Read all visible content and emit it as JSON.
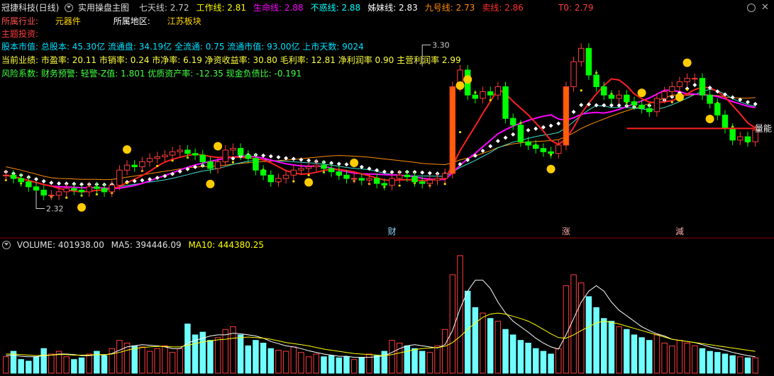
{
  "header": {
    "stock_name": "冠捷科技(日线)",
    "indicator_name": "实用操盘主图",
    "lines": [
      {
        "label": "七天线:",
        "value": "2.72",
        "color": "#c8c8c8"
      },
      {
        "label": "工作线:",
        "value": "2.81",
        "color": "#ffff00"
      },
      {
        "label": "生命线:",
        "value": "2.88",
        "color": "#ff00ff"
      },
      {
        "label": "不惑线:",
        "value": "2.88",
        "color": "#00ffff"
      },
      {
        "label": "姊妹线:",
        "value": "2.83",
        "color": "#ffffff"
      },
      {
        "label": "九号线:",
        "value": "2.73",
        "color": "#ff8c00"
      },
      {
        "label": "卖线:",
        "value": "2.86",
        "color": "#ff3030"
      }
    ],
    "t0": "T0: 2.79"
  },
  "info": {
    "industry_label": "所属行业:",
    "industry_value": "元器件",
    "region_label": "所属地区:",
    "region_value": "江苏板块",
    "theme_label": "主题投资:",
    "line1": "股本市值: 总股本: 45.30亿 流通盘: 34.19亿 全流通: 0.75 流通市值: 93.00亿 上市天数: 9024",
    "line2": "当前业绩: 市盈率: 20.11 市销率: 0.24 市净率: 6.19 净资收益率: 30.80 毛利率: 12.81 净利润率 0.90 主营利润率 2.99",
    "line3": "风险系数: 财务预警: 轻警-Z值: 1.801 优质资产率: -12.35 现金负债比: -0.191"
  },
  "volume_header": {
    "volume": "VOLUME: 401938.00",
    "ma5": "MA5: 394446.09",
    "ma10": "MA10: 444380.25"
  },
  "chart_data": {
    "type": "candlestick",
    "price_ylim": [
      2.22,
      3.4
    ],
    "annotations": {
      "high_label": "3.30",
      "low_label": "2.32",
      "right_label": "量能"
    },
    "event_markers": [
      {
        "label": "财",
        "index": 51
      },
      {
        "label": "涨",
        "index": 74
      },
      {
        "label": "減",
        "index": 89
      }
    ],
    "colors": {
      "up": "#ff3c3c",
      "down": "#00e8e8",
      "down_candle": "#00ff00",
      "yellow": "#ffd700",
      "magenta": "#ff00ff",
      "white": "#ffffff",
      "orange": "#ff8c00"
    },
    "closes": [
      2.52,
      2.5,
      2.48,
      2.45,
      2.43,
      2.4,
      2.4,
      2.42,
      2.44,
      2.43,
      2.42,
      2.45,
      2.44,
      2.42,
      2.46,
      2.55,
      2.58,
      2.57,
      2.6,
      2.62,
      2.63,
      2.64,
      2.66,
      2.67,
      2.65,
      2.64,
      2.6,
      2.56,
      2.6,
      2.67,
      2.68,
      2.64,
      2.62,
      2.55,
      2.52,
      2.48,
      2.5,
      2.52,
      2.55,
      2.56,
      2.57,
      2.58,
      2.56,
      2.54,
      2.52,
      2.5,
      2.5,
      2.49,
      2.5,
      2.47,
      2.46,
      2.5,
      2.52,
      2.51,
      2.48,
      2.47,
      2.49,
      2.5,
      2.53,
      3.05,
      3.15,
      3.0,
      2.98,
      3.02,
      3.0,
      3.05,
      2.86,
      2.82,
      2.72,
      2.7,
      2.68,
      2.66,
      2.65,
      2.7,
      3.05,
      3.2,
      3.28,
      3.12,
      3.05,
      3.0,
      2.98,
      3.0,
      2.96,
      2.94,
      2.92,
      2.9,
      2.98,
      3.02,
      3.05,
      3.08,
      3.1,
      3.1,
      3.0,
      2.95,
      2.88,
      2.8,
      2.73,
      2.75,
      2.72,
      2.79
    ],
    "volumes": [
      30,
      40,
      25,
      22,
      30,
      45,
      35,
      40,
      30,
      25,
      28,
      35,
      40,
      32,
      45,
      60,
      55,
      50,
      48,
      40,
      45,
      50,
      38,
      45,
      90,
      70,
      75,
      60,
      65,
      80,
      85,
      70,
      50,
      60,
      55,
      45,
      42,
      40,
      48,
      38,
      30,
      35,
      30,
      32,
      28,
      30,
      25,
      28,
      35,
      32,
      40,
      60,
      55,
      50,
      45,
      40,
      38,
      50,
      80,
      180,
      215,
      150,
      120,
      110,
      100,
      95,
      80,
      70,
      60,
      55,
      45,
      40,
      35,
      45,
      160,
      180,
      165,
      140,
      120,
      100,
      95,
      85,
      80,
      70,
      65,
      60,
      70,
      55,
      50,
      60,
      55,
      50,
      45,
      40,
      38,
      35,
      32,
      30,
      28,
      28
    ],
    "ma_vol_5": [
      32,
      33,
      31,
      30,
      30,
      32,
      33,
      35,
      35,
      34,
      32,
      32,
      34,
      33,
      36,
      42,
      48,
      50,
      52,
      51,
      50,
      48,
      45,
      45,
      55,
      60,
      64,
      68,
      70,
      70,
      73,
      72,
      70,
      68,
      64,
      58,
      54,
      50,
      48,
      45,
      41,
      38,
      35,
      33,
      31,
      31,
      29,
      29,
      29,
      30,
      32,
      38,
      45,
      50,
      52,
      50,
      48,
      46,
      52,
      78,
      118,
      150,
      170,
      170,
      155,
      130,
      110,
      95,
      85,
      75,
      64,
      55,
      48,
      44,
      70,
      100,
      130,
      150,
      160,
      150,
      130,
      115,
      105,
      95,
      85,
      78,
      72,
      68,
      62,
      60,
      58,
      56,
      52,
      48,
      45,
      42,
      38,
      35,
      32,
      30
    ],
    "ma_vol_10": [
      35,
      35,
      34,
      33,
      32,
      33,
      33,
      34,
      34,
      33,
      33,
      33,
      34,
      34,
      35,
      38,
      42,
      45,
      47,
      48,
      49,
      49,
      48,
      48,
      51,
      54,
      57,
      59,
      61,
      62,
      64,
      65,
      66,
      65,
      64,
      62,
      59,
      56,
      54,
      52,
      50,
      47,
      44,
      42,
      40,
      38,
      36,
      35,
      34,
      33,
      32,
      34,
      37,
      40,
      43,
      45,
      46,
      47,
      49,
      56,
      67,
      80,
      92,
      102,
      108,
      110,
      108,
      104,
      100,
      95,
      88,
      80,
      72,
      65,
      64,
      70,
      78,
      85,
      92,
      95,
      93,
      90,
      86,
      82,
      78,
      74,
      70,
      66,
      62,
      60,
      58,
      56,
      54,
      52,
      50,
      48,
      46,
      44,
      42,
      40
    ]
  }
}
